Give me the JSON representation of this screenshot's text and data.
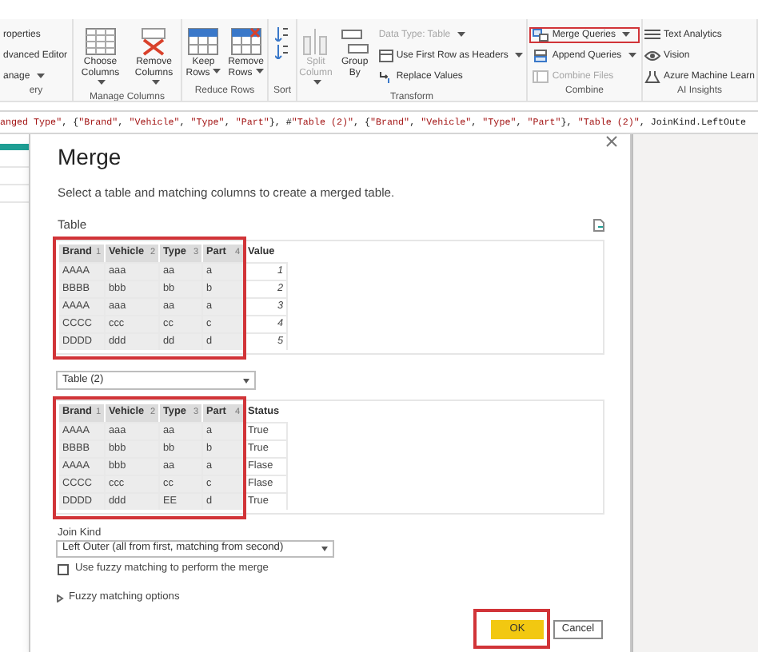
{
  "ribbon": {
    "groups": [
      {
        "label": "ery",
        "items": [
          {
            "kind": "stack",
            "entries": [
              {
                "label": "roperties",
                "dropdown": false,
                "disabled": false,
                "highlighted": false
              },
              {
                "label": "dvanced Editor",
                "dropdown": false,
                "disabled": false,
                "highlighted": false
              },
              {
                "label": "anage",
                "dropdown": true,
                "disabled": false,
                "highlighted": false
              }
            ]
          }
        ]
      },
      {
        "label": "Manage Columns",
        "items": [
          {
            "kind": "large",
            "label": "Choose Columns",
            "dropdown": true,
            "disabled": false
          },
          {
            "kind": "large",
            "label": "Remove Columns",
            "dropdown": true,
            "disabled": false
          }
        ]
      },
      {
        "label": "Reduce Rows",
        "items": [
          {
            "kind": "large",
            "label": "Keep Rows",
            "dropdown": true,
            "disabled": false
          },
          {
            "kind": "large",
            "label": "Remove Rows",
            "dropdown": true,
            "disabled": false
          }
        ]
      },
      {
        "label": "Sort",
        "items": [
          {
            "kind": "sort"
          }
        ]
      },
      {
        "label": "Transform",
        "items": [
          {
            "kind": "large",
            "label": "Split Column",
            "dropdown": true,
            "disabled": true
          },
          {
            "kind": "large",
            "label": "Group By",
            "dropdown": false,
            "disabled": false
          },
          {
            "kind": "stack",
            "entries": [
              {
                "label": "Data Type: Table",
                "dropdown": true,
                "disabled": true,
                "highlighted": false
              },
              {
                "label": "Use First Row as Headers",
                "dropdown": true,
                "disabled": false,
                "highlighted": false
              },
              {
                "label": "Replace Values",
                "dropdown": false,
                "disabled": false,
                "highlighted": false
              }
            ]
          }
        ]
      },
      {
        "label": "Combine",
        "items": [
          {
            "kind": "stack",
            "entries": [
              {
                "label": "Merge Queries",
                "dropdown": true,
                "disabled": false,
                "highlighted": true
              },
              {
                "label": "Append Queries",
                "dropdown": true,
                "disabled": false,
                "highlighted": false
              },
              {
                "label": "Combine Files",
                "dropdown": false,
                "disabled": true,
                "highlighted": false
              }
            ]
          }
        ]
      },
      {
        "label": "AI Insights",
        "items": [
          {
            "kind": "stack",
            "entries": [
              {
                "label": "Text Analytics",
                "dropdown": false,
                "disabled": false,
                "highlighted": false
              },
              {
                "label": "Vision",
                "dropdown": false,
                "disabled": false,
                "highlighted": false
              },
              {
                "label": "Azure Machine Learn",
                "dropdown": false,
                "disabled": false,
                "highlighted": false
              }
            ]
          }
        ]
      }
    ]
  },
  "formula": [
    {
      "text": "anged Type\"",
      "kind": "string"
    },
    {
      "text": ", {",
      "kind": "plain"
    },
    {
      "text": "\"Brand\"",
      "kind": "string"
    },
    {
      "text": ", ",
      "kind": "plain"
    },
    {
      "text": "\"Vehicle\"",
      "kind": "string"
    },
    {
      "text": ", ",
      "kind": "plain"
    },
    {
      "text": "\"Type\"",
      "kind": "string"
    },
    {
      "text": ", ",
      "kind": "plain"
    },
    {
      "text": "\"Part\"",
      "kind": "string"
    },
    {
      "text": "}, #",
      "kind": "plain"
    },
    {
      "text": "\"Table (2)\"",
      "kind": "string"
    },
    {
      "text": ", {",
      "kind": "plain"
    },
    {
      "text": "\"Brand\"",
      "kind": "string"
    },
    {
      "text": ", ",
      "kind": "plain"
    },
    {
      "text": "\"Vehicle\"",
      "kind": "string"
    },
    {
      "text": ", ",
      "kind": "plain"
    },
    {
      "text": "\"Type\"",
      "kind": "string"
    },
    {
      "text": ", ",
      "kind": "plain"
    },
    {
      "text": "\"Part\"",
      "kind": "string"
    },
    {
      "text": "}, ",
      "kind": "plain"
    },
    {
      "text": "\"Table (2)\"",
      "kind": "string"
    },
    {
      "text": ", JoinKind.LeftOute",
      "kind": "plain"
    }
  ],
  "dialog": {
    "title": "Merge",
    "description": "Select a table and matching columns to create a merged table.",
    "table_label": "Table",
    "tables": [
      {
        "highlighted": true,
        "columns": [
          {
            "label": "Brand",
            "index": "1",
            "selected": true,
            "kind": "text"
          },
          {
            "label": "Vehicle",
            "index": "2",
            "selected": true,
            "kind": "text"
          },
          {
            "label": "Type",
            "index": "3",
            "selected": true,
            "kind": "text"
          },
          {
            "label": "Part",
            "index": "4",
            "selected": true,
            "kind": "text"
          },
          {
            "label": "Value",
            "selected": false,
            "kind": "number"
          }
        ],
        "rows": [
          [
            "AAAA",
            "aaa",
            "aa",
            "a",
            "1"
          ],
          [
            "BBBB",
            "bbb",
            "bb",
            "b",
            "2"
          ],
          [
            "AAAA",
            "aaa",
            "aa",
            "a",
            "3"
          ],
          [
            "CCCC",
            "ccc",
            "cc",
            "c",
            "4"
          ],
          [
            "DDDD",
            "ddd",
            "dd",
            "d",
            "5"
          ]
        ]
      },
      {
        "highlighted": true,
        "columns": [
          {
            "label": "Brand",
            "index": "1",
            "selected": true,
            "kind": "text"
          },
          {
            "label": "Vehicle",
            "index": "2",
            "selected": true,
            "kind": "text"
          },
          {
            "label": "Type",
            "index": "3",
            "selected": true,
            "kind": "text"
          },
          {
            "label": "Part",
            "index": "4",
            "selected": true,
            "kind": "text"
          },
          {
            "label": "Status",
            "selected": false,
            "kind": "text"
          }
        ],
        "rows": [
          [
            "AAAA",
            "aaa",
            "aa",
            "a",
            "True"
          ],
          [
            "BBBB",
            "bbb",
            "bb",
            "b",
            "True"
          ],
          [
            "AAAA",
            "bbb",
            "aa",
            "a",
            "Flase"
          ],
          [
            "CCCC",
            "ccc",
            "cc",
            "c",
            "Flase"
          ],
          [
            "DDDD",
            "ddd",
            "EE",
            "d",
            "True"
          ]
        ]
      }
    ],
    "second_table_select": {
      "value": "Table (2)"
    },
    "join_kind": {
      "label": "Join Kind",
      "value": "Left Outer (all from first, matching from second)"
    },
    "fuzzy": {
      "label": "Use fuzzy matching to perform the merge",
      "checked": false
    },
    "fuzzy_options": {
      "label": "Fuzzy matching options",
      "expanded": false
    },
    "buttons": [
      {
        "label": "OK",
        "kind": "primary",
        "highlighted": true
      },
      {
        "label": "Cancel",
        "kind": "secondary",
        "highlighted": false
      }
    ]
  }
}
